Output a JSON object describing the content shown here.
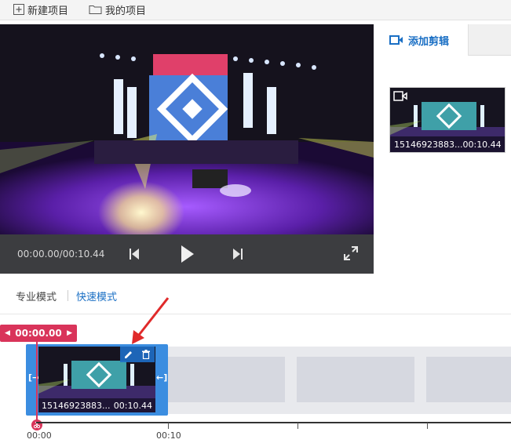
{
  "toolbar": {
    "new_project": "新建项目",
    "my_projects": "我的项目"
  },
  "player": {
    "timecode": "00:00.00/00:10.44",
    "icons": [
      "skip-back-icon",
      "play-icon",
      "skip-forward-icon",
      "fullscreen-icon"
    ]
  },
  "right_panel": {
    "tab_label": "添加剪辑",
    "clip": {
      "name": "15146923883...",
      "duration": "00:10.44"
    }
  },
  "modes": {
    "pro": "专业模式",
    "quick": "快速模式",
    "active": "quick"
  },
  "timeline": {
    "playhead_time": "00:00.00",
    "clip": {
      "name": "15146923883...",
      "duration": "00:10.44"
    },
    "ruler_labels": [
      "00:00",
      "00:10"
    ]
  },
  "colors": {
    "accent": "#1a6fc4",
    "playhead": "#d9345a",
    "selected_clip": "#3b8de0",
    "annotation_arrow": "#e02a2a"
  }
}
